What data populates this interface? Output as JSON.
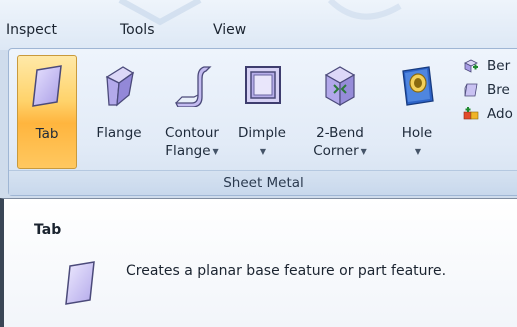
{
  "menu": [
    {
      "label": "Inspect"
    },
    {
      "label": "Tools"
    },
    {
      "label": "View"
    }
  ],
  "ribbon": {
    "group_label": "Sheet Metal",
    "buttons": [
      {
        "line1": "Tab",
        "line2": "",
        "dropdown": false,
        "active": true,
        "icon": "tab-plate-icon"
      },
      {
        "line1": "Flange",
        "line2": "",
        "dropdown": false,
        "active": false,
        "icon": "flange-icon"
      },
      {
        "line1": "Contour",
        "line2": "Flange",
        "dropdown": true,
        "active": false,
        "icon": "contour-flange-icon"
      },
      {
        "line1": "Dimple",
        "line2": "",
        "dropdown": true,
        "active": false,
        "icon": "dimple-icon"
      },
      {
        "line1": "2-Bend",
        "line2": "Corner",
        "dropdown": true,
        "active": false,
        "icon": "two-bend-corner-icon"
      },
      {
        "line1": "Hole",
        "line2": "",
        "dropdown": true,
        "active": false,
        "icon": "hole-icon"
      }
    ],
    "small_buttons": [
      {
        "label": "Ber",
        "icon": "bend-icon"
      },
      {
        "label": "Bre",
        "icon": "break-corner-icon"
      },
      {
        "label": "Ado",
        "icon": "add-icon"
      }
    ]
  },
  "tooltip": {
    "title": "Tab",
    "description": "Creates a planar base feature or part feature.",
    "icon": "tab-plate-icon"
  },
  "colors": {
    "active_button": "#ffd36b",
    "ribbon_bg": "#e2ebf7",
    "accent_blue": "#1e5bb8"
  }
}
